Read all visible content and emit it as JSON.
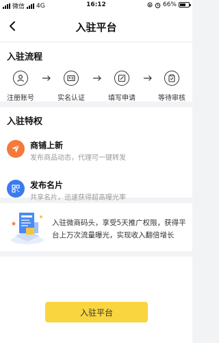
{
  "status_bar": {
    "carrier": "微信",
    "network": "4G",
    "time": "16:12",
    "battery": "66%",
    "battery_level": 0.66
  },
  "nav": {
    "title": "入驻平台"
  },
  "process": {
    "title": "入驻流程",
    "steps": [
      {
        "label": "注册账号",
        "icon": "user-icon"
      },
      {
        "label": "实名认证",
        "icon": "id-card-icon"
      },
      {
        "label": "填写申请",
        "icon": "edit-icon"
      },
      {
        "label": "等待审核",
        "icon": "clipboard-icon"
      }
    ]
  },
  "privileges": {
    "title": "入驻特权",
    "items": [
      {
        "title": "商铺上新",
        "subtitle": "发布商品动态，代理可一键转发",
        "icon": "send-icon",
        "color": "#f47a3a"
      },
      {
        "title": "发布名片",
        "subtitle": "共享名片，迅速获得超高曝光率",
        "icon": "qr-code-icon",
        "color": "#3a7bf0"
      }
    ]
  },
  "promo": {
    "text": "入驻微商码头，享受5天推广权限，获得平台上万次流量曝光，实现收入翻倍增长"
  },
  "cta": {
    "label": "入驻平台",
    "color": "#f9d53f"
  }
}
